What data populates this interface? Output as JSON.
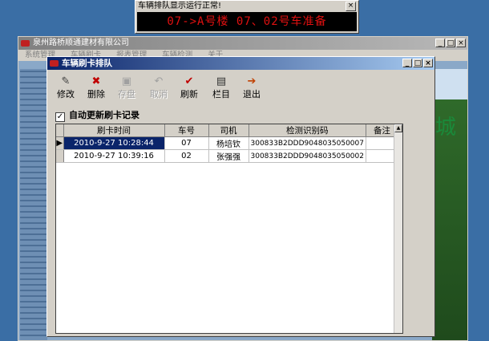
{
  "led_popup": {
    "title": "车辆排队显示运行正常!",
    "close": "×",
    "message": "07->A号楼  07、02号车准备"
  },
  "main_window": {
    "title": "泉州路桥顺通建材有限公司",
    "controls": {
      "minimize": "_",
      "maximize": "□",
      "close": "×"
    },
    "menu": [
      "系统管理",
      "车辆刷卡",
      "报表管理",
      "车辆检测",
      "关于"
    ]
  },
  "background": {
    "glyph": "城"
  },
  "child_window": {
    "title": "车辆刷卡排队",
    "controls": {
      "minimize": "_",
      "maximize": "□",
      "close": "×"
    },
    "toolbar": [
      {
        "icon": "edit-icon",
        "glyph": "✎",
        "label": "修改",
        "enabled": true
      },
      {
        "icon": "delete-icon",
        "glyph": "✖",
        "label": "删除",
        "enabled": true
      },
      {
        "icon": "save-icon",
        "glyph": "▣",
        "label": "存盘",
        "enabled": false
      },
      {
        "icon": "cancel-icon",
        "glyph": "↶",
        "label": "取消",
        "enabled": false
      },
      {
        "icon": "refresh-icon",
        "glyph": "✔",
        "label": "刷新",
        "enabled": true
      },
      {
        "icon": "columns-icon",
        "glyph": "▤",
        "label": "栏目",
        "enabled": true
      },
      {
        "icon": "exit-icon",
        "glyph": "➔",
        "label": "退出",
        "enabled": true
      }
    ],
    "auto_update": {
      "checked": true,
      "label": "自动更新刷卡记录"
    },
    "grid": {
      "columns": [
        "刷卡时间",
        "车号",
        "司机",
        "检测识别码",
        "备注"
      ],
      "rows": [
        {
          "selected": true,
          "time": "2010-9-27 10:28:44",
          "car": "07",
          "driver": "杨培钦",
          "code": "300833B2DDD9048035050007",
          "note": ""
        },
        {
          "selected": false,
          "time": "2010-9-27 10:39:16",
          "car": "02",
          "driver": "张强强",
          "code": "300833B2DDD9048035050002",
          "note": ""
        }
      ]
    },
    "colors": {
      "title_bar": "#0a246a",
      "selection": "#0a246a"
    }
  }
}
